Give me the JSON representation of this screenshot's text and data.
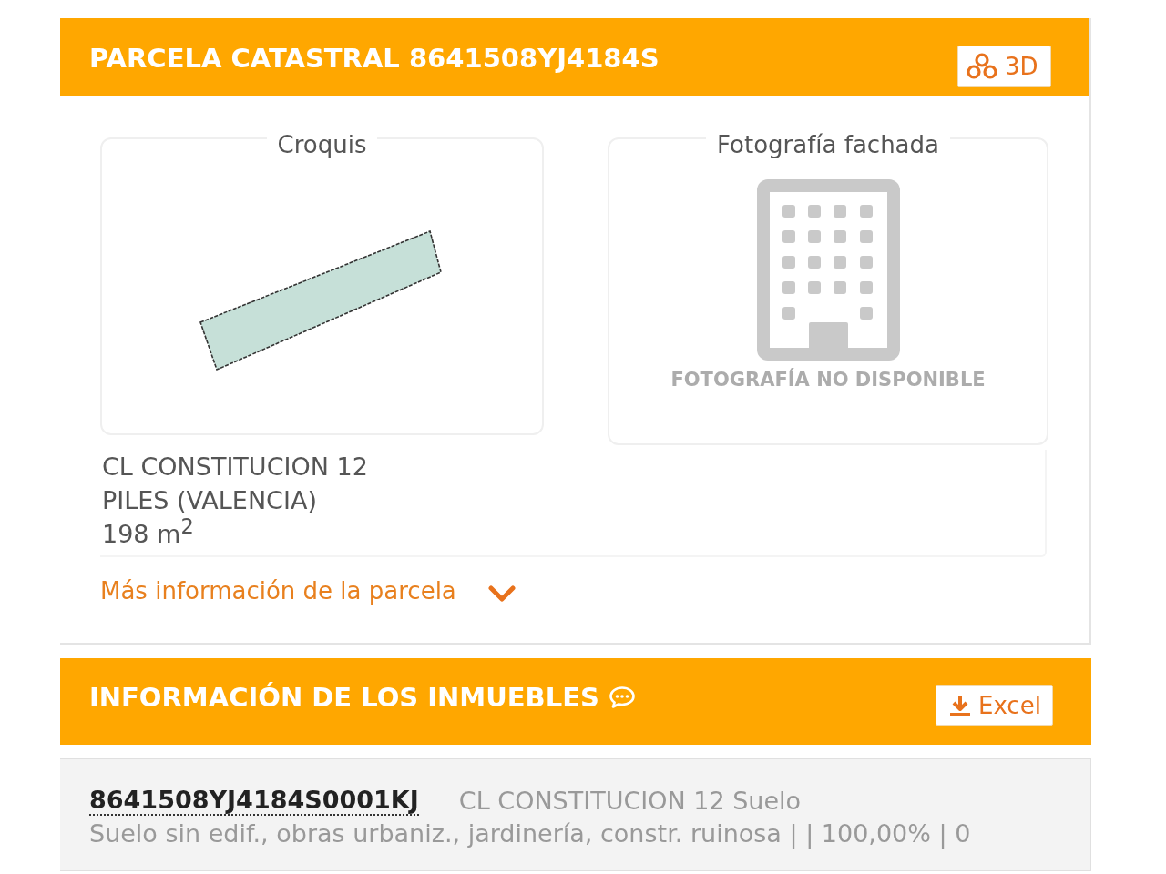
{
  "parcel_panel": {
    "title": "PARCELA CATASTRAL 8641508YJ4184S",
    "button": "3D",
    "sketch": {
      "legend": "Croquis"
    },
    "facade_photo": {
      "legend": "Fotografía fachada",
      "message": "FOTOGRAFÍA NO DISPONIBLE"
    },
    "address_lines": [
      "CL CONSTITUCION 12",
      "PILES (VALENCIA)",
      "198 m$^{2}$"
    ],
    "more_info_link": {
      "label": "Más información de la parcela",
      "expanded": false
    }
  },
  "properties_panel": {
    "title": "INFORMACIÓN DE LOS INMUEBLES",
    "button": "Excel",
    "rows": [
      {
        "reference": "8641508YJ4184S0001KJ",
        "address": "CL CONSTITUCION 12 Suelo",
        "details": "Suelo sin edif., obras urbaniz., jardinería, constr. ruinosa | | 100,00% | 0"
      }
    ]
  }
}
